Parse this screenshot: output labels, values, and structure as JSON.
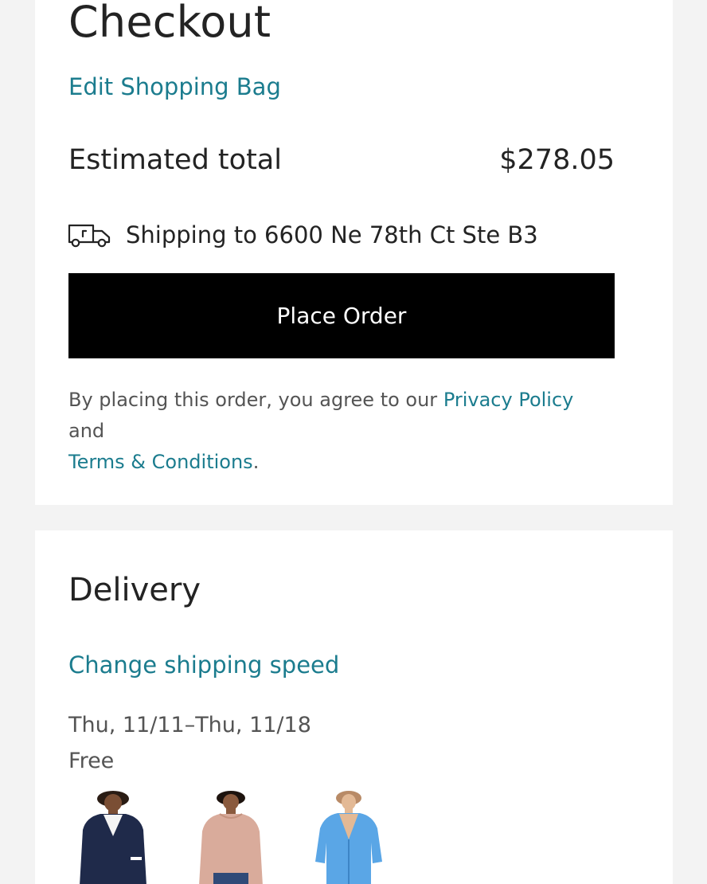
{
  "checkout": {
    "title": "Checkout",
    "edit_bag_label": "Edit Shopping Bag",
    "estimated_total_label": "Estimated total",
    "estimated_total_value": "$278.05",
    "shipping_text": "Shipping to 6600 Ne 78th Ct Ste B3",
    "shipping_icon": "truck-icon",
    "place_order_label": "Place Order",
    "legal": {
      "prefix": "By placing this order, you agree to our ",
      "privacy_link": "Privacy Policy",
      "middle": " and ",
      "terms_link": "Terms & Conditions",
      "suffix": "."
    }
  },
  "delivery": {
    "title": "Delivery",
    "change_speed_label": "Change shipping speed",
    "date_range": "Thu, 11/11–Thu, 11/18",
    "cost": "Free",
    "items": [
      {
        "name": "navy-cardigan",
        "color": "#1f2a4a"
      },
      {
        "name": "blush-sweater",
        "color": "#d9ab9b"
      },
      {
        "name": "blue-cardigan",
        "color": "#5aa6e6"
      }
    ]
  },
  "colors": {
    "link": "#1b7c8e",
    "button": "#000000",
    "background": "#f3f3f3",
    "card": "#ffffff"
  }
}
